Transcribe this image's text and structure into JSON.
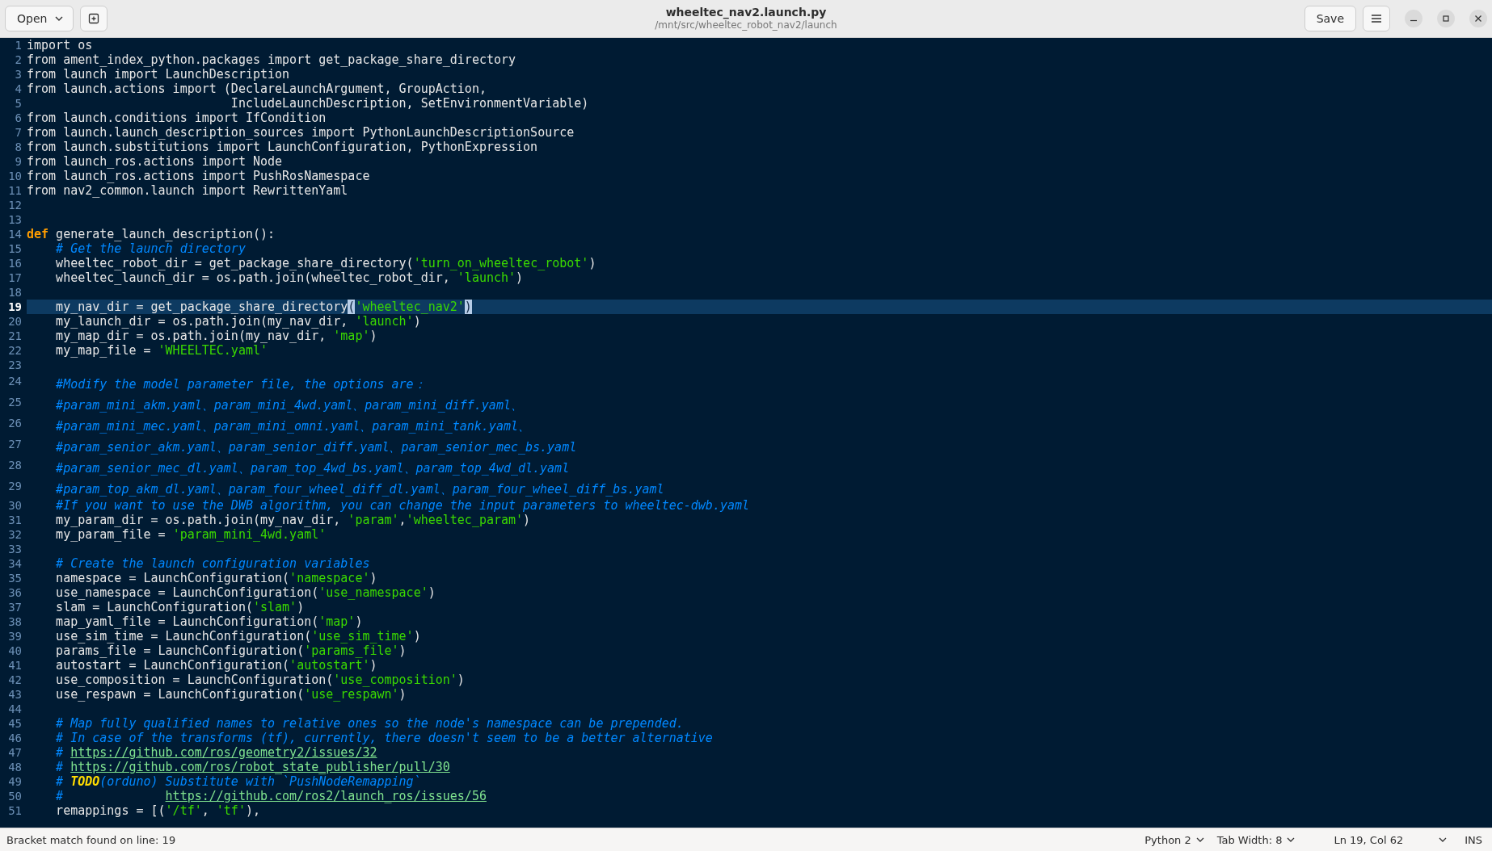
{
  "header": {
    "open_button": "Open",
    "title": "wheeltec_nav2.launch.py",
    "path": "/mnt/src/wheeltec_robot_nav2/launch",
    "save_button": "Save"
  },
  "editor": {
    "lines": [
      {
        "number": "1",
        "current": false,
        "tokens": [
          {
            "text": "import os",
            "kind": "plain"
          }
        ]
      },
      {
        "number": "2",
        "current": false,
        "tokens": [
          {
            "text": "from ament_index_python.packages import get_package_share_directory",
            "kind": "plain"
          }
        ]
      },
      {
        "number": "3",
        "current": false,
        "tokens": [
          {
            "text": "from launch import LaunchDescription",
            "kind": "plain"
          }
        ]
      },
      {
        "number": "4",
        "current": false,
        "tokens": [
          {
            "text": "from launch.actions import (DeclareLaunchArgument, GroupAction,",
            "kind": "plain"
          }
        ]
      },
      {
        "number": "5",
        "current": false,
        "tokens": [
          {
            "text": "                            IncludeLaunchDescription, SetEnvironmentVariable)",
            "kind": "plain"
          }
        ]
      },
      {
        "number": "6",
        "current": false,
        "tokens": [
          {
            "text": "from launch.conditions import IfCondition",
            "kind": "plain"
          }
        ]
      },
      {
        "number": "7",
        "current": false,
        "tokens": [
          {
            "text": "from launch.launch_description_sources import PythonLaunchDescriptionSource",
            "kind": "plain"
          }
        ]
      },
      {
        "number": "8",
        "current": false,
        "tokens": [
          {
            "text": "from launch.substitutions import LaunchConfiguration, PythonExpression",
            "kind": "plain"
          }
        ]
      },
      {
        "number": "9",
        "current": false,
        "tokens": [
          {
            "text": "from launch_ros.actions import Node",
            "kind": "plain"
          }
        ]
      },
      {
        "number": "10",
        "current": false,
        "tokens": [
          {
            "text": "from launch_ros.actions import PushRosNamespace",
            "kind": "plain"
          }
        ]
      },
      {
        "number": "11",
        "current": false,
        "tokens": [
          {
            "text": "from nav2_common.launch import RewrittenYaml",
            "kind": "plain"
          }
        ]
      },
      {
        "number": "12",
        "current": false
      },
      {
        "number": "13",
        "current": false
      },
      {
        "number": "14",
        "current": false,
        "tokens": [
          {
            "text": "def",
            "kind": "keyword"
          },
          {
            "text": " generate_launch_description():",
            "kind": "plain"
          }
        ]
      },
      {
        "number": "15",
        "current": false,
        "tokens": [
          {
            "text": "    # Get the launch directory",
            "kind": "comment"
          }
        ]
      },
      {
        "number": "16",
        "current": false,
        "tokens": [
          {
            "text": "    wheeltec_robot_dir = get_package_share_directory(",
            "kind": "plain"
          },
          {
            "text": "'turn_on_wheeltec_robot'",
            "kind": "string"
          },
          {
            "text": ")",
            "kind": "plain"
          }
        ]
      },
      {
        "number": "17",
        "current": false,
        "tokens": [
          {
            "text": "    wheeltec_launch_dir = os.path.join(wheeltec_robot_dir, ",
            "kind": "plain"
          },
          {
            "text": "'launch'",
            "kind": "string"
          },
          {
            "text": ")",
            "kind": "plain"
          }
        ]
      },
      {
        "number": "18",
        "current": false
      },
      {
        "number": "19",
        "current": true,
        "tokens": [
          {
            "text": "    my_nav_dir = get_package_share_directory",
            "kind": "plain"
          },
          {
            "text": "(",
            "kind": "match"
          },
          {
            "text": "'wheeltec_nav2'",
            "kind": "string"
          },
          {
            "text": ")",
            "kind": "match"
          }
        ]
      },
      {
        "number": "20",
        "current": false,
        "tokens": [
          {
            "text": "    my_launch_dir = os.path.join(my_nav_dir, ",
            "kind": "plain"
          },
          {
            "text": "'launch'",
            "kind": "string"
          },
          {
            "text": ")",
            "kind": "plain"
          }
        ]
      },
      {
        "number": "21",
        "current": false,
        "tokens": [
          {
            "text": "    my_map_dir = os.path.join(my_nav_dir, ",
            "kind": "plain"
          },
          {
            "text": "'map'",
            "kind": "string"
          },
          {
            "text": ")",
            "kind": "plain"
          }
        ]
      },
      {
        "number": "22",
        "current": false,
        "tokens": [
          {
            "text": "    my_map_file = ",
            "kind": "plain"
          },
          {
            "text": "'WHEELTEC.yaml'",
            "kind": "string"
          }
        ]
      },
      {
        "number": "23",
        "current": false
      },
      {
        "number": "24",
        "current": false,
        "tokens": [
          {
            "text": "    #Modify the model parameter file, the options are：",
            "kind": "comment"
          }
        ]
      },
      {
        "number": "25",
        "current": false,
        "tokens": [
          {
            "text": "    #param_mini_akm.yaml、param_mini_4wd.yaml、param_mini_diff.yaml、",
            "kind": "comment"
          }
        ]
      },
      {
        "number": "26",
        "current": false,
        "tokens": [
          {
            "text": "    #param_mini_mec.yaml、param_mini_omni.yaml、param_mini_tank.yaml、",
            "kind": "comment"
          }
        ]
      },
      {
        "number": "27",
        "current": false,
        "tokens": [
          {
            "text": "    #param_senior_akm.yaml、param_senior_diff.yaml、param_senior_mec_bs.yaml",
            "kind": "comment"
          }
        ]
      },
      {
        "number": "28",
        "current": false,
        "tokens": [
          {
            "text": "    #param_senior_mec_dl.yaml、param_top_4wd_bs.yaml、param_top_4wd_dl.yaml",
            "kind": "comment"
          }
        ]
      },
      {
        "number": "29",
        "current": false,
        "tokens": [
          {
            "text": "    #param_top_akm_dl.yaml、param_four_wheel_diff_dl.yaml、param_four_wheel_diff_bs.yaml",
            "kind": "comment"
          }
        ]
      },
      {
        "number": "30",
        "current": false,
        "tokens": [
          {
            "text": "    #If you want to use the DWB algorithm, you can change the input parameters to wheeltec-dwb.yaml",
            "kind": "comment"
          }
        ]
      },
      {
        "number": "31",
        "current": false,
        "tokens": [
          {
            "text": "    my_param_dir = os.path.join(my_nav_dir, ",
            "kind": "plain"
          },
          {
            "text": "'param'",
            "kind": "string"
          },
          {
            "text": ",",
            "kind": "plain"
          },
          {
            "text": "'wheeltec_param'",
            "kind": "string"
          },
          {
            "text": ")",
            "kind": "plain"
          }
        ]
      },
      {
        "number": "32",
        "current": false,
        "tokens": [
          {
            "text": "    my_param_file = ",
            "kind": "plain"
          },
          {
            "text": "'param_mini_4wd.yaml'",
            "kind": "string"
          }
        ]
      },
      {
        "number": "33",
        "current": false
      },
      {
        "number": "34",
        "current": false,
        "tokens": [
          {
            "text": "    # Create the launch configuration variables",
            "kind": "comment"
          }
        ]
      },
      {
        "number": "35",
        "current": false,
        "tokens": [
          {
            "text": "    namespace = LaunchConfiguration(",
            "kind": "plain"
          },
          {
            "text": "'namespace'",
            "kind": "string"
          },
          {
            "text": ")",
            "kind": "plain"
          }
        ]
      },
      {
        "number": "36",
        "current": false,
        "tokens": [
          {
            "text": "    use_namespace = LaunchConfiguration(",
            "kind": "plain"
          },
          {
            "text": "'use_namespace'",
            "kind": "string"
          },
          {
            "text": ")",
            "kind": "plain"
          }
        ]
      },
      {
        "number": "37",
        "current": false,
        "tokens": [
          {
            "text": "    slam = LaunchConfiguration(",
            "kind": "plain"
          },
          {
            "text": "'slam'",
            "kind": "string"
          },
          {
            "text": ")",
            "kind": "plain"
          }
        ]
      },
      {
        "number": "38",
        "current": false,
        "tokens": [
          {
            "text": "    map_yaml_file = LaunchConfiguration(",
            "kind": "plain"
          },
          {
            "text": "'map'",
            "kind": "string"
          },
          {
            "text": ")",
            "kind": "plain"
          }
        ]
      },
      {
        "number": "39",
        "current": false,
        "tokens": [
          {
            "text": "    use_sim_time = LaunchConfiguration(",
            "kind": "plain"
          },
          {
            "text": "'use_sim_time'",
            "kind": "string"
          },
          {
            "text": ")",
            "kind": "plain"
          }
        ]
      },
      {
        "number": "40",
        "current": false,
        "tokens": [
          {
            "text": "    params_file = LaunchConfiguration(",
            "kind": "plain"
          },
          {
            "text": "'params_file'",
            "kind": "string"
          },
          {
            "text": ")",
            "kind": "plain"
          }
        ]
      },
      {
        "number": "41",
        "current": false,
        "tokens": [
          {
            "text": "    autostart = LaunchConfiguration(",
            "kind": "plain"
          },
          {
            "text": "'autostart'",
            "kind": "string"
          },
          {
            "text": ")",
            "kind": "plain"
          }
        ]
      },
      {
        "number": "42",
        "current": false,
        "tokens": [
          {
            "text": "    use_composition = LaunchConfiguration(",
            "kind": "plain"
          },
          {
            "text": "'use_composition'",
            "kind": "string"
          },
          {
            "text": ")",
            "kind": "plain"
          }
        ]
      },
      {
        "number": "43",
        "current": false,
        "tokens": [
          {
            "text": "    use_respawn = LaunchConfiguration(",
            "kind": "plain"
          },
          {
            "text": "'use_respawn'",
            "kind": "string"
          },
          {
            "text": ")",
            "kind": "plain"
          }
        ]
      },
      {
        "number": "44",
        "current": false
      },
      {
        "number": "45",
        "current": false,
        "tokens": [
          {
            "text": "    # Map fully qualified names to relative ones so the node's namespace can be prepended.",
            "kind": "comment"
          }
        ]
      },
      {
        "number": "46",
        "current": false,
        "tokens": [
          {
            "text": "    # In case of the transforms (tf), currently, there doesn't seem to be a better alternative",
            "kind": "comment"
          }
        ]
      },
      {
        "number": "47",
        "current": false,
        "tokens": [
          {
            "text": "    # ",
            "kind": "comment"
          },
          {
            "text": "https://github.com/ros/geometry2/issues/32",
            "kind": "link"
          }
        ]
      },
      {
        "number": "48",
        "current": false,
        "tokens": [
          {
            "text": "    # ",
            "kind": "comment"
          },
          {
            "text": "https://github.com/ros/robot_state_publisher/pull/30",
            "kind": "link"
          }
        ]
      },
      {
        "number": "49",
        "current": false,
        "tokens": [
          {
            "text": "    # ",
            "kind": "comment"
          },
          {
            "text": "TODO",
            "kind": "todo"
          },
          {
            "text": "(orduno) Substitute with `PushNodeRemapping`",
            "kind": "comment"
          }
        ]
      },
      {
        "number": "50",
        "current": false,
        "tokens": [
          {
            "text": "    #              ",
            "kind": "comment"
          },
          {
            "text": "https://github.com/ros2/launch_ros/issues/56",
            "kind": "link"
          }
        ]
      },
      {
        "number": "51",
        "current": false,
        "tokens": [
          {
            "text": "    remappings = [(",
            "kind": "plain"
          },
          {
            "text": "'/tf'",
            "kind": "string"
          },
          {
            "text": ", ",
            "kind": "plain"
          },
          {
            "text": "'tf'",
            "kind": "string"
          },
          {
            "text": "),",
            "kind": "plain"
          }
        ]
      }
    ]
  },
  "status_bar": {
    "message": "Bracket match found on line: 19",
    "language": "Python 2",
    "tab_width": "Tab Width: 8",
    "position": "Ln 19, Col 62",
    "mode": "INS"
  }
}
